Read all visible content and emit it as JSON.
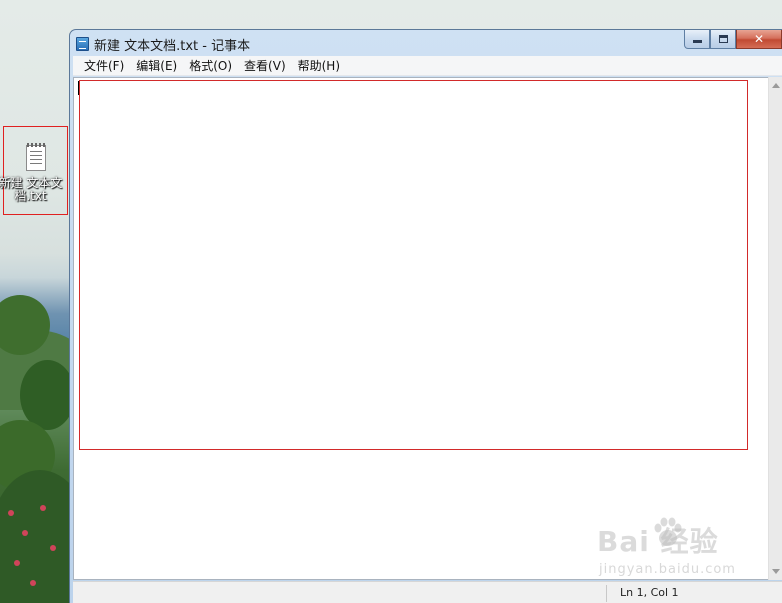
{
  "desktop": {
    "icon_label": "新建 文本文档.txt"
  },
  "window": {
    "title": "新建 文本文档.txt - 记事本",
    "caption": {
      "close_symbol": "✕"
    },
    "menu": [
      "文件(F)",
      "编辑(E)",
      "格式(O)",
      "查看(V)",
      "帮助(H)"
    ],
    "editor_text": "",
    "status": {
      "position": "Ln 1, Col 1"
    }
  },
  "watermark": {
    "main": "Bai  经验",
    "sub": "jingyan.baidu.com"
  },
  "colors": {
    "highlight_border": "#d22a2a",
    "titlebar": "#cfe1f3",
    "close_button": "#c14a32"
  }
}
